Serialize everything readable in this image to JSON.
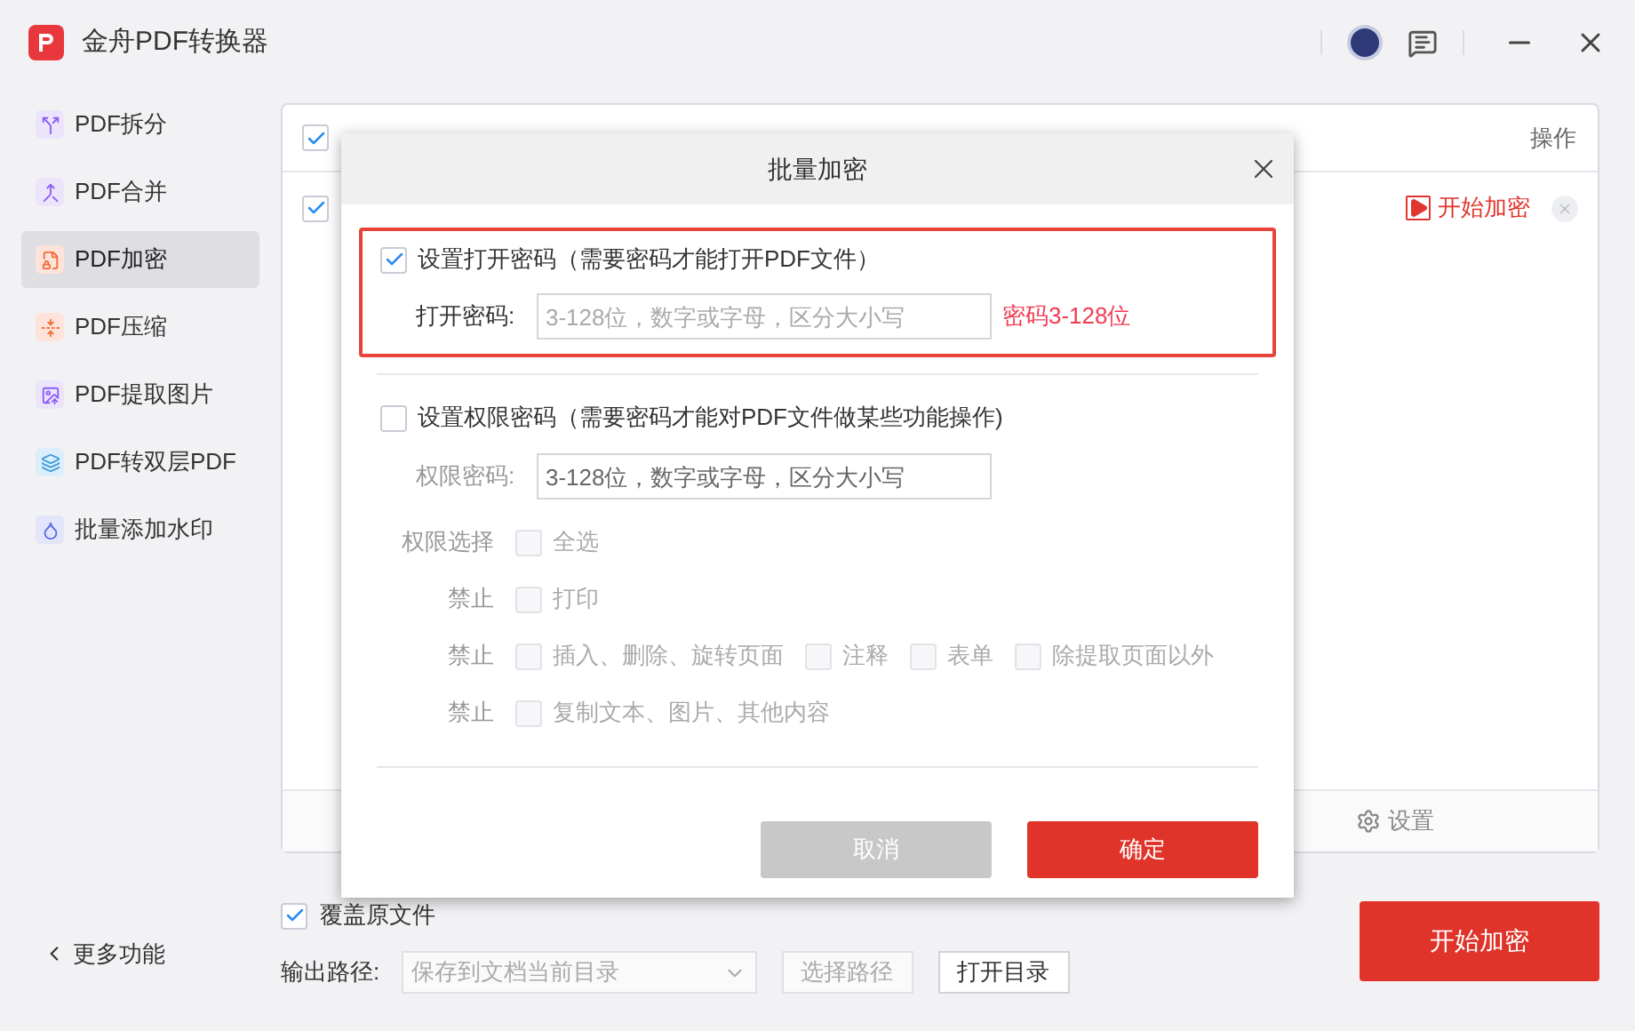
{
  "app": {
    "title": "金舟PDF转换器"
  },
  "sidebar": {
    "items": [
      {
        "label": "PDF拆分",
        "selected": false,
        "kind": "split"
      },
      {
        "label": "PDF合并",
        "selected": false,
        "kind": "merge"
      },
      {
        "label": "PDF加密",
        "selected": true,
        "kind": "lock"
      },
      {
        "label": "PDF压缩",
        "selected": false,
        "kind": "compress"
      },
      {
        "label": "PDF提取图片",
        "selected": false,
        "kind": "image"
      },
      {
        "label": "PDF转双层PDF",
        "selected": false,
        "kind": "layers"
      },
      {
        "label": "批量添加水印",
        "selected": false,
        "kind": "watermark"
      }
    ],
    "more_link": "更多功能"
  },
  "file_table": {
    "header_checked": true,
    "column_action": "操作",
    "rows": [
      {
        "checked": true,
        "action": "开始加密"
      }
    ],
    "settings": "设置"
  },
  "overwrite": {
    "label": "覆盖原文件",
    "checked": true
  },
  "output": {
    "label": "输出路径:",
    "value": "保存到文档当前目录",
    "choose_button": "选择路径",
    "open_button": "打开目录"
  },
  "start_button": "开始加密",
  "dialog": {
    "title": "批量加密",
    "open_password": {
      "label": "设置打开密码（需要密码才能打开PDF文件）",
      "checked": true,
      "highlighted": true,
      "field_label": "打开密码:",
      "placeholder": "3-128位，数字或字母，区分大小写",
      "error": "密码3-128位"
    },
    "permission_password": {
      "label": "设置权限密码（需要密码才能对PDF文件做某些功能操作)",
      "checked": false,
      "field_label": "权限密码:",
      "placeholder": "3-128位，数字或字母，区分大小写"
    },
    "permissions": [
      {
        "label": "权限选择",
        "options": [
          {
            "label": "全选",
            "checked": false
          }
        ]
      },
      {
        "label": "禁止",
        "options": [
          {
            "label": "打印",
            "checked": false
          }
        ]
      },
      {
        "label": "禁止",
        "options": [
          {
            "label": "插入、删除、旋转页面",
            "checked": false
          },
          {
            "label": "注释",
            "checked": false
          },
          {
            "label": "表单",
            "checked": false
          },
          {
            "label": "除提取页面以外",
            "checked": false
          }
        ]
      },
      {
        "label": "禁止",
        "options": [
          {
            "label": "复制文本、图片、其他内容",
            "checked": false
          }
        ]
      }
    ],
    "cancel": "取消",
    "ok": "确定"
  }
}
